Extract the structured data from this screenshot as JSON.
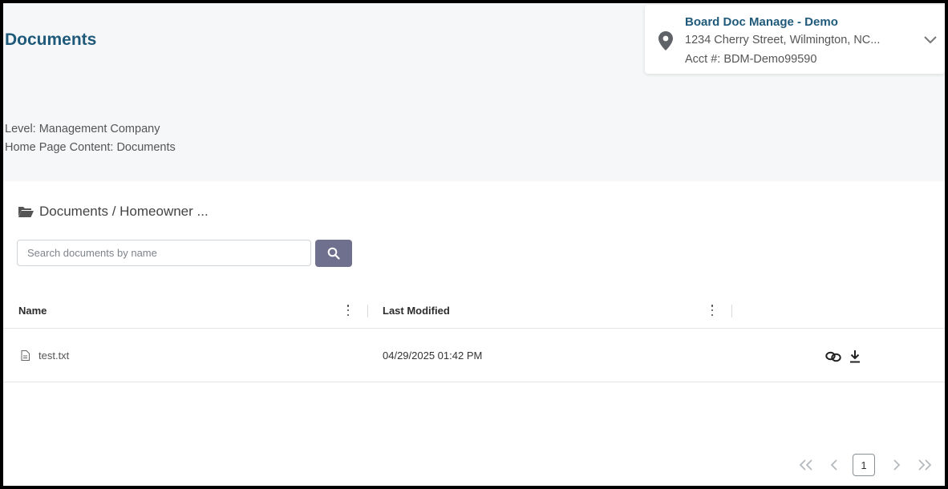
{
  "header": {
    "page_title": "Documents"
  },
  "account": {
    "name": "Board Doc Manage - Demo",
    "address": "1234 Cherry Street, Wilmington, NC...",
    "account_number": "Acct #: BDM-Demo99590",
    "icon": "map-pin-icon",
    "expand_icon": "chevron-down-icon"
  },
  "meta": {
    "level": "Level: Management Company",
    "home_page_content": "Home Page Content: Documents"
  },
  "breadcrumb": {
    "icon": "folder-open-icon",
    "path": "Documents / Homeowner ..."
  },
  "search": {
    "placeholder": "Search documents by name",
    "value": "",
    "button_icon": "search-icon"
  },
  "table": {
    "columns": [
      "Name",
      "Last Modified"
    ],
    "rows": [
      {
        "name": "test.txt",
        "last_modified": "04/29/2025 01:42 PM",
        "icon": "file-icon",
        "actions": [
          "link-icon",
          "download-icon"
        ]
      }
    ]
  },
  "pagination": {
    "current_page": "1",
    "controls": [
      "first-page-icon",
      "previous-page-icon",
      "next-page-icon",
      "last-page-icon"
    ]
  },
  "colors": {
    "title": "#1f5a7a",
    "search_button": "#6f6f8e",
    "top_background": "#f5f7f8"
  }
}
